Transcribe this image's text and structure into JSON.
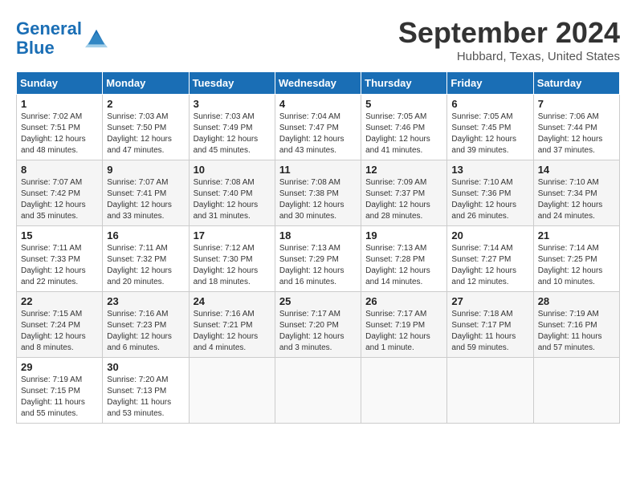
{
  "header": {
    "logo_line1": "General",
    "logo_line2": "Blue",
    "month": "September 2024",
    "location": "Hubbard, Texas, United States"
  },
  "weekdays": [
    "Sunday",
    "Monday",
    "Tuesday",
    "Wednesday",
    "Thursday",
    "Friday",
    "Saturday"
  ],
  "weeks": [
    [
      {
        "day": "1",
        "info": "Sunrise: 7:02 AM\nSunset: 7:51 PM\nDaylight: 12 hours\nand 48 minutes."
      },
      {
        "day": "2",
        "info": "Sunrise: 7:03 AM\nSunset: 7:50 PM\nDaylight: 12 hours\nand 47 minutes."
      },
      {
        "day": "3",
        "info": "Sunrise: 7:03 AM\nSunset: 7:49 PM\nDaylight: 12 hours\nand 45 minutes."
      },
      {
        "day": "4",
        "info": "Sunrise: 7:04 AM\nSunset: 7:47 PM\nDaylight: 12 hours\nand 43 minutes."
      },
      {
        "day": "5",
        "info": "Sunrise: 7:05 AM\nSunset: 7:46 PM\nDaylight: 12 hours\nand 41 minutes."
      },
      {
        "day": "6",
        "info": "Sunrise: 7:05 AM\nSunset: 7:45 PM\nDaylight: 12 hours\nand 39 minutes."
      },
      {
        "day": "7",
        "info": "Sunrise: 7:06 AM\nSunset: 7:44 PM\nDaylight: 12 hours\nand 37 minutes."
      }
    ],
    [
      {
        "day": "8",
        "info": "Sunrise: 7:07 AM\nSunset: 7:42 PM\nDaylight: 12 hours\nand 35 minutes."
      },
      {
        "day": "9",
        "info": "Sunrise: 7:07 AM\nSunset: 7:41 PM\nDaylight: 12 hours\nand 33 minutes."
      },
      {
        "day": "10",
        "info": "Sunrise: 7:08 AM\nSunset: 7:40 PM\nDaylight: 12 hours\nand 31 minutes."
      },
      {
        "day": "11",
        "info": "Sunrise: 7:08 AM\nSunset: 7:38 PM\nDaylight: 12 hours\nand 30 minutes."
      },
      {
        "day": "12",
        "info": "Sunrise: 7:09 AM\nSunset: 7:37 PM\nDaylight: 12 hours\nand 28 minutes."
      },
      {
        "day": "13",
        "info": "Sunrise: 7:10 AM\nSunset: 7:36 PM\nDaylight: 12 hours\nand 26 minutes."
      },
      {
        "day": "14",
        "info": "Sunrise: 7:10 AM\nSunset: 7:34 PM\nDaylight: 12 hours\nand 24 minutes."
      }
    ],
    [
      {
        "day": "15",
        "info": "Sunrise: 7:11 AM\nSunset: 7:33 PM\nDaylight: 12 hours\nand 22 minutes."
      },
      {
        "day": "16",
        "info": "Sunrise: 7:11 AM\nSunset: 7:32 PM\nDaylight: 12 hours\nand 20 minutes."
      },
      {
        "day": "17",
        "info": "Sunrise: 7:12 AM\nSunset: 7:30 PM\nDaylight: 12 hours\nand 18 minutes."
      },
      {
        "day": "18",
        "info": "Sunrise: 7:13 AM\nSunset: 7:29 PM\nDaylight: 12 hours\nand 16 minutes."
      },
      {
        "day": "19",
        "info": "Sunrise: 7:13 AM\nSunset: 7:28 PM\nDaylight: 12 hours\nand 14 minutes."
      },
      {
        "day": "20",
        "info": "Sunrise: 7:14 AM\nSunset: 7:27 PM\nDaylight: 12 hours\nand 12 minutes."
      },
      {
        "day": "21",
        "info": "Sunrise: 7:14 AM\nSunset: 7:25 PM\nDaylight: 12 hours\nand 10 minutes."
      }
    ],
    [
      {
        "day": "22",
        "info": "Sunrise: 7:15 AM\nSunset: 7:24 PM\nDaylight: 12 hours\nand 8 minutes."
      },
      {
        "day": "23",
        "info": "Sunrise: 7:16 AM\nSunset: 7:23 PM\nDaylight: 12 hours\nand 6 minutes."
      },
      {
        "day": "24",
        "info": "Sunrise: 7:16 AM\nSunset: 7:21 PM\nDaylight: 12 hours\nand 4 minutes."
      },
      {
        "day": "25",
        "info": "Sunrise: 7:17 AM\nSunset: 7:20 PM\nDaylight: 12 hours\nand 3 minutes."
      },
      {
        "day": "26",
        "info": "Sunrise: 7:17 AM\nSunset: 7:19 PM\nDaylight: 12 hours\nand 1 minute."
      },
      {
        "day": "27",
        "info": "Sunrise: 7:18 AM\nSunset: 7:17 PM\nDaylight: 11 hours\nand 59 minutes."
      },
      {
        "day": "28",
        "info": "Sunrise: 7:19 AM\nSunset: 7:16 PM\nDaylight: 11 hours\nand 57 minutes."
      }
    ],
    [
      {
        "day": "29",
        "info": "Sunrise: 7:19 AM\nSunset: 7:15 PM\nDaylight: 11 hours\nand 55 minutes."
      },
      {
        "day": "30",
        "info": "Sunrise: 7:20 AM\nSunset: 7:13 PM\nDaylight: 11 hours\nand 53 minutes."
      },
      {
        "day": "",
        "info": ""
      },
      {
        "day": "",
        "info": ""
      },
      {
        "day": "",
        "info": ""
      },
      {
        "day": "",
        "info": ""
      },
      {
        "day": "",
        "info": ""
      }
    ]
  ]
}
